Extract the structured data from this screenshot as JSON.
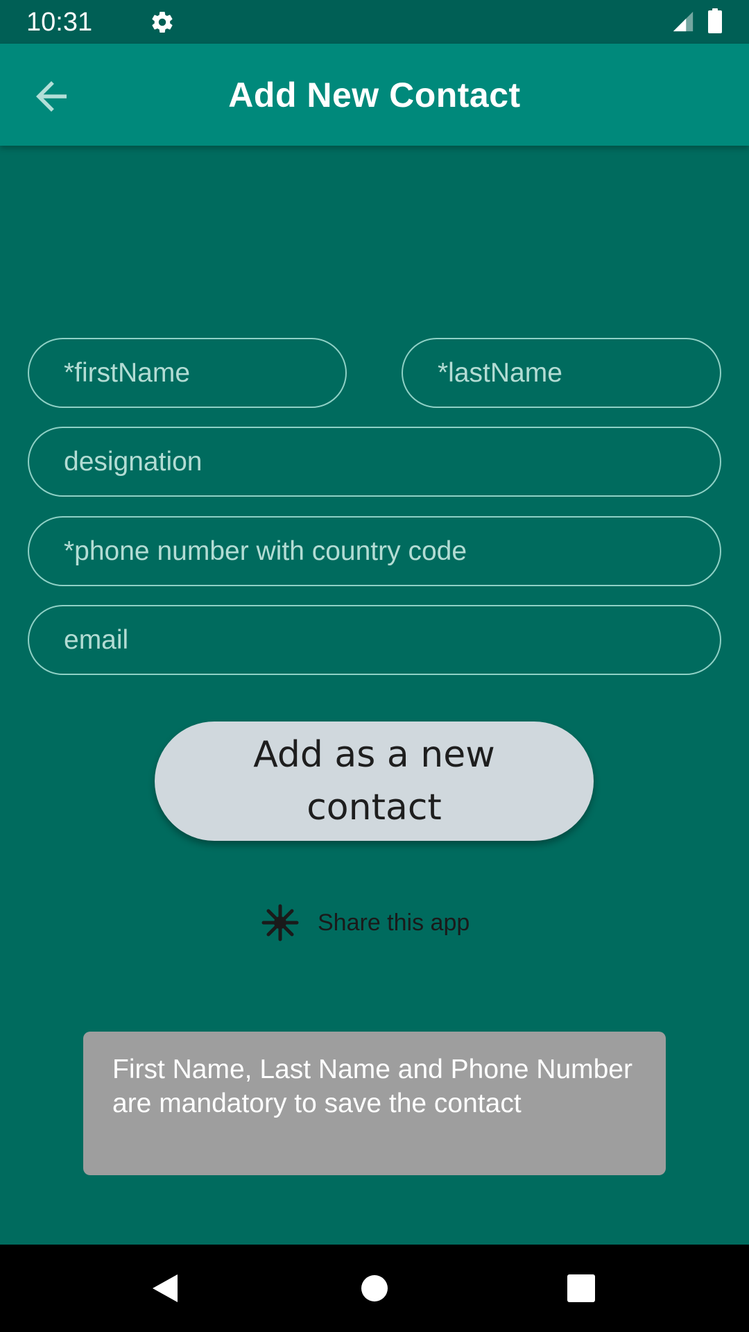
{
  "status_bar": {
    "time": "10:31",
    "icons": [
      "gear-icon",
      "signal-icon",
      "battery-icon"
    ]
  },
  "app_bar": {
    "title": "Add New Contact",
    "back_icon": "arrow-back-icon"
  },
  "form": {
    "first_name_placeholder": "*firstName",
    "last_name_placeholder": "*lastName",
    "designation_placeholder": "designation",
    "phone_placeholder": "*phone number with country code",
    "email_placeholder": "email"
  },
  "add_button_label": "Add as a new contact",
  "share": {
    "label": "Share this app",
    "icon": "share-asterisk-icon"
  },
  "toast": {
    "message": "First Name, Last Name and Phone Number are mandatory to save the contact"
  },
  "nav_bar": {
    "icons": [
      "nav-back-icon",
      "nav-home-icon",
      "nav-recents-icon"
    ]
  },
  "colors": {
    "background": "#006B5E",
    "status_bar": "#005F55",
    "app_bar": "#00897B",
    "field_border": "#8FD1C6",
    "button": "#D0D8DD",
    "toast": "#9E9E9E"
  }
}
